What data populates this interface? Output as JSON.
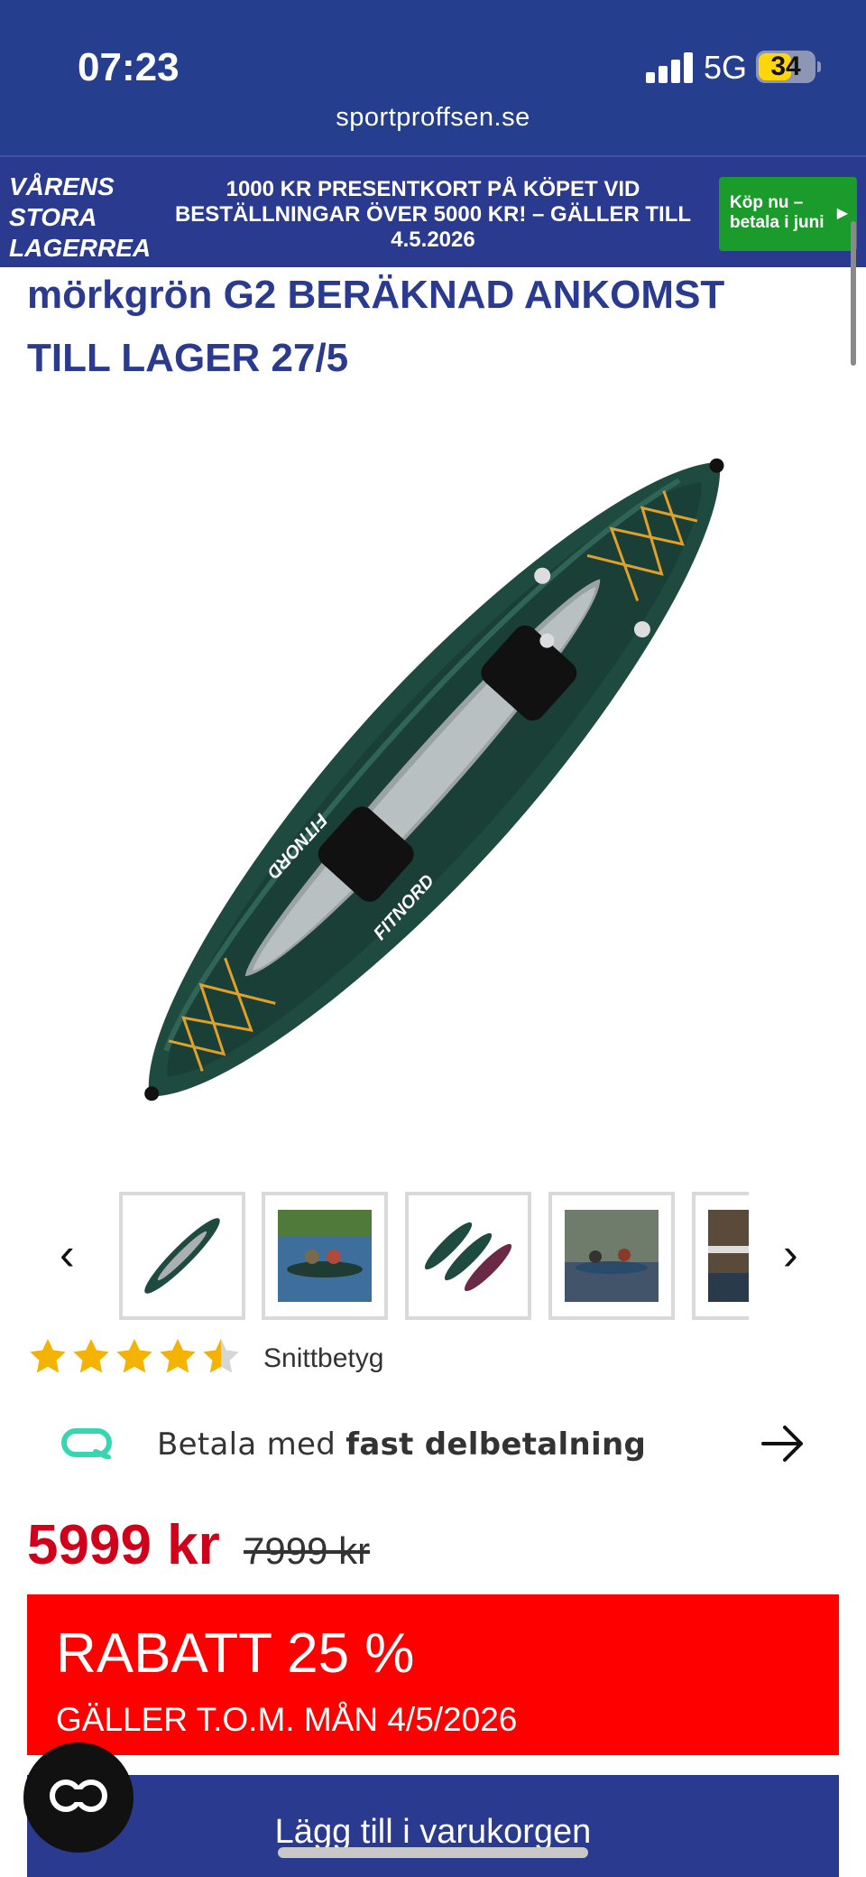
{
  "status_bar": {
    "time": "07:23",
    "network": "5G",
    "battery": "34",
    "battery_level": 0.34
  },
  "browser": {
    "url": "sportproffsen.se"
  },
  "promo_banner": {
    "left_line1": "VÅRENS",
    "left_line2": "STORA",
    "left_line3": "LAGERREA",
    "message": "1000 KR PRESENTKORT PÅ KÖPET VID BESTÄLLNINGAR ÖVER 5000 KR! – GÄLLER TILL 4.5.2026",
    "button_line1": "Köp nu –",
    "button_line2": "betala i juni",
    "button_color": "#1c9b2d"
  },
  "product": {
    "title_line1": "mörkgrön G2 BERÄKNAD ANKOMST",
    "title_line2": "TILL LAGER 27/5",
    "image_icon": "inflatable-kayak-image"
  },
  "gallery": {
    "prev": "‹",
    "next": "›",
    "thumbnails": [
      {
        "icon": "kayak-thumbnail"
      },
      {
        "icon": "kayak-on-water-thumbnail"
      },
      {
        "icon": "kayak-colors-thumbnail"
      },
      {
        "icon": "kayakers-river-thumbnail"
      },
      {
        "icon": "kayak-dock-thumbnail"
      }
    ]
  },
  "rating": {
    "value": 4.5,
    "max": 5,
    "label": "Snittbetyg"
  },
  "payment": {
    "text_prefix": "Betala med ",
    "text_bold": "fast delbetalning",
    "logo_icon": "qliro-logo-icon",
    "logo_color": "#36d6b2"
  },
  "pricing": {
    "price": "5999 kr",
    "old_price": "7999 kr",
    "price_color": "#d0021b"
  },
  "discount": {
    "headline": "RABATT 25 %",
    "valid": "GÄLLER T.O.M. MÅN 4/5/2026",
    "color": "#ff0000"
  },
  "cart": {
    "label": "Lägg till i varukorgen",
    "color": "#2a3a8f"
  },
  "chat_button": {
    "icon": "chat-icon"
  }
}
